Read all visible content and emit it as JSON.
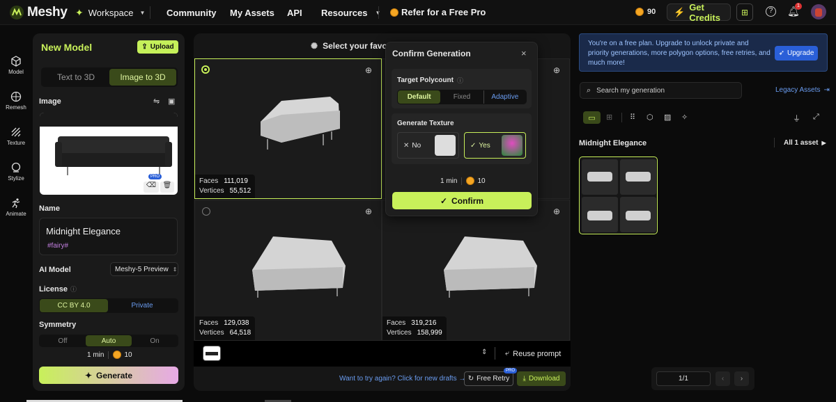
{
  "topbar": {
    "logo": "Meshy",
    "workspace": "Workspace",
    "nav": [
      "Community",
      "My Assets",
      "API",
      "Resources"
    ],
    "refer": "Refer for a Free Pro",
    "credits_count": "90",
    "get_credits": "Get Credits",
    "notif_count": "1"
  },
  "sidebar": [
    "Model",
    "Remesh",
    "Texture",
    "Stylize",
    "Animate"
  ],
  "left": {
    "title": "New Model",
    "upload": "Upload",
    "tabs": [
      "Text to 3D",
      "Image to 3D"
    ],
    "image_label": "Image",
    "pro_badge": "PRO",
    "name_label": "Name",
    "name_value": "Midnight Elegance",
    "tag": "#fairy#",
    "ai_model_label": "AI Model",
    "ai_model_value": "Meshy-5 Preview",
    "license_label": "License",
    "license_options": [
      "CC BY 4.0",
      "Private"
    ],
    "symmetry_label": "Symmetry",
    "symmetry_options": [
      "Off",
      "Auto",
      "On"
    ],
    "time": "1 min",
    "cost": "10",
    "generate": "Generate"
  },
  "center": {
    "header": "Select your favori",
    "cells": [
      {
        "faces": "111,019",
        "vertices": "55,512"
      },
      {
        "faces": "129,038",
        "vertices": "64,518"
      },
      {
        "faces": "319,216",
        "vertices": "158,999"
      }
    ],
    "faces_label": "Faces",
    "vertices_label": "Vertices",
    "reuse_prompt": "Reuse prompt",
    "try_again": "Want to try again? Click for new drafts →",
    "free_retry": "Free Retry",
    "pro_badge": "PRO",
    "download": "Download"
  },
  "dialog": {
    "title": "Confirm Generation",
    "polycount_label": "Target Polycount",
    "polycount_options": [
      "Default",
      "Fixed",
      "Adaptive"
    ],
    "texture_label": "Generate Texture",
    "no": "No",
    "yes": "Yes",
    "time": "1 min",
    "cost": "10",
    "confirm": "Confirm"
  },
  "right": {
    "banner": "You're on a free plan. Upgrade to unlock private and priority generations, more polygon options, free retries, and much more!",
    "upgrade": "Upgrade",
    "search_placeholder": "Search my generation",
    "legacy": "Legacy Assets",
    "asset_name": "Midnight Elegance",
    "asset_count": "All 1 asset",
    "pagination": "1/1"
  }
}
